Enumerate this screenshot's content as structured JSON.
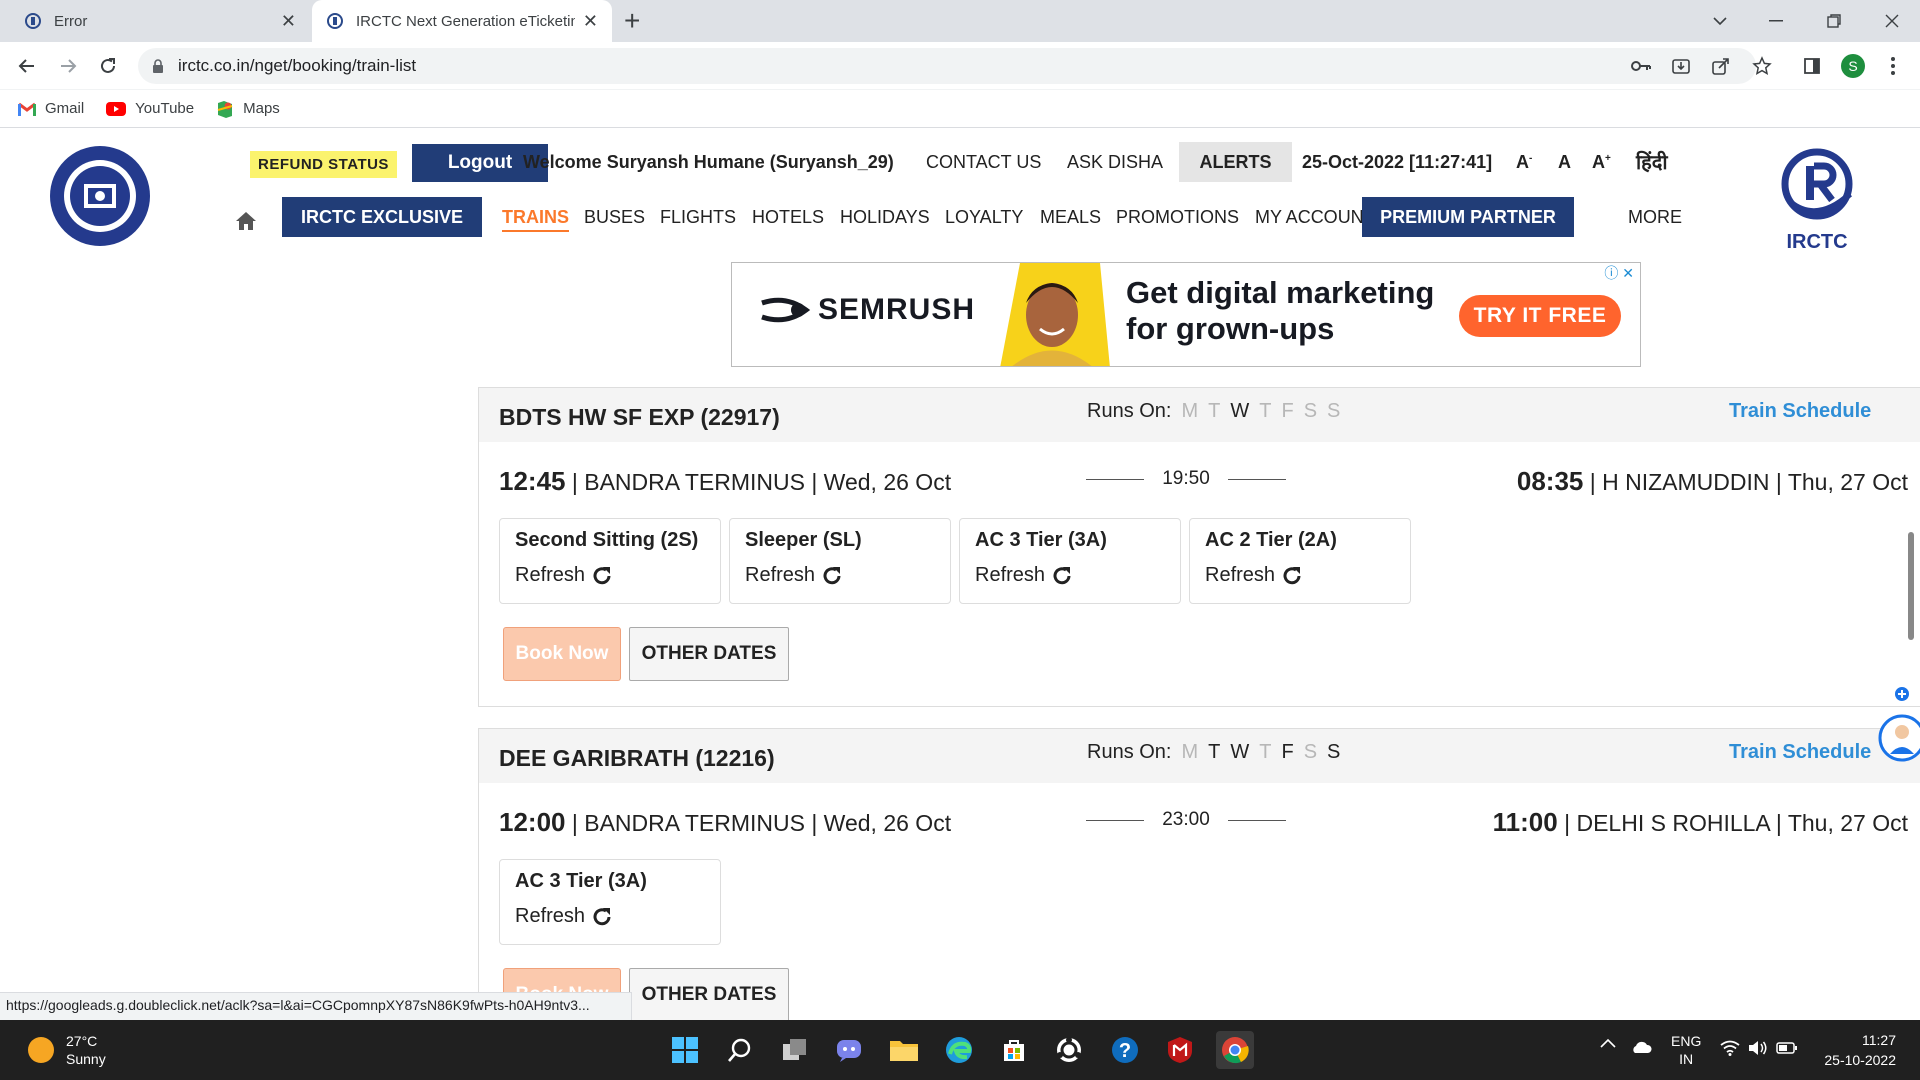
{
  "browser": {
    "tabs": [
      {
        "title": "Error",
        "active": false
      },
      {
        "title": "IRCTC Next Generation eTicketing System",
        "active": true
      }
    ],
    "url": "irctc.co.in/nget/booking/train-list",
    "bookmarks": [
      {
        "label": "Gmail",
        "icon": "gmail-icon"
      },
      {
        "label": "YouTube",
        "icon": "youtube-icon"
      },
      {
        "label": "Maps",
        "icon": "maps-icon"
      }
    ],
    "profile_initial": "S"
  },
  "header": {
    "refund_status": "REFUND STATUS",
    "logout": "Logout",
    "welcome": "Welcome Suryansh Humane (Suryansh_29)",
    "contact_us": "CONTACT US",
    "ask_disha": "ASK DISHA",
    "alerts": "ALERTS",
    "datetime": "25-Oct-2022 [11:27:41]",
    "font_small": "A",
    "font_normal": "A",
    "font_large": "A",
    "hindi": "हिंदी",
    "irctc_logo_text": "IRCTC",
    "colors": {
      "navy": "#213d77",
      "orange": "#fb792b",
      "refund_bg": "#fbf36d"
    }
  },
  "nav": {
    "exclusive": "IRCTC EXCLUSIVE",
    "items": [
      "TRAINS",
      "BUSES",
      "FLIGHTS",
      "HOTELS",
      "HOLIDAYS",
      "LOYALTY",
      "MEALS",
      "PROMOTIONS",
      "MY ACCOUNT"
    ],
    "active": "TRAINS",
    "premium_partner": "PREMIUM PARTNER",
    "more": "MORE"
  },
  "ad": {
    "brand": "SEMRUSH",
    "slogan_line1": "Get digital marketing",
    "slogan_line2": "for grown-ups",
    "cta": "TRY IT FREE"
  },
  "trains": [
    {
      "name": "BDTS HW SF EXP (22917)",
      "runs_on_label": "Runs On:",
      "days": [
        {
          "d": "M",
          "runs": false
        },
        {
          "d": "T",
          "runs": false
        },
        {
          "d": "W",
          "runs": true
        },
        {
          "d": "T",
          "runs": false
        },
        {
          "d": "F",
          "runs": false
        },
        {
          "d": "S",
          "runs": false
        },
        {
          "d": "S",
          "runs": false
        }
      ],
      "schedule_link": "Train Schedule",
      "dep_time": "12:45",
      "dep_station": " | BANDRA TERMINUS | Wed, 26 Oct",
      "duration": "19:50",
      "arr_time": "08:35",
      "arr_station": " | H NIZAMUDDIN | Thu, 27 Oct",
      "classes": [
        {
          "name": "Second Sitting (2S)",
          "action": "Refresh"
        },
        {
          "name": "Sleeper (SL)",
          "action": "Refresh"
        },
        {
          "name": "AC 3 Tier (3A)",
          "action": "Refresh"
        },
        {
          "name": "AC 2 Tier (2A)",
          "action": "Refresh"
        }
      ],
      "book_now": "Book Now",
      "other_dates": "OTHER DATES"
    },
    {
      "name": "DEE GARIBRATH (12216)",
      "runs_on_label": "Runs On:",
      "days": [
        {
          "d": "M",
          "runs": false
        },
        {
          "d": "T",
          "runs": true
        },
        {
          "d": "W",
          "runs": true
        },
        {
          "d": "T",
          "runs": false
        },
        {
          "d": "F",
          "runs": true
        },
        {
          "d": "S",
          "runs": false
        },
        {
          "d": "S",
          "runs": true
        }
      ],
      "schedule_link": "Train Schedule",
      "dep_time": "12:00",
      "dep_station": " | BANDRA TERMINUS | Wed, 26 Oct",
      "duration": "23:00",
      "arr_time": "11:00",
      "arr_station": " | DELHI S ROHILLA | Thu, 27 Oct",
      "classes": [
        {
          "name": "AC 3 Tier (3A)",
          "action": "Refresh"
        }
      ],
      "book_now": "Book Now",
      "other_dates": "OTHER DATES"
    }
  ],
  "status_url": "https://googleads.g.doubleclick.net/aclk?sa=l&ai=CGCpomnpXY87sN86K9fwPts-h0AH9ntv3...",
  "taskbar": {
    "temperature": "27°C",
    "weather": "Sunny",
    "lang1": "ENG",
    "lang2": "IN",
    "time": "11:27",
    "date": "25-10-2022"
  }
}
